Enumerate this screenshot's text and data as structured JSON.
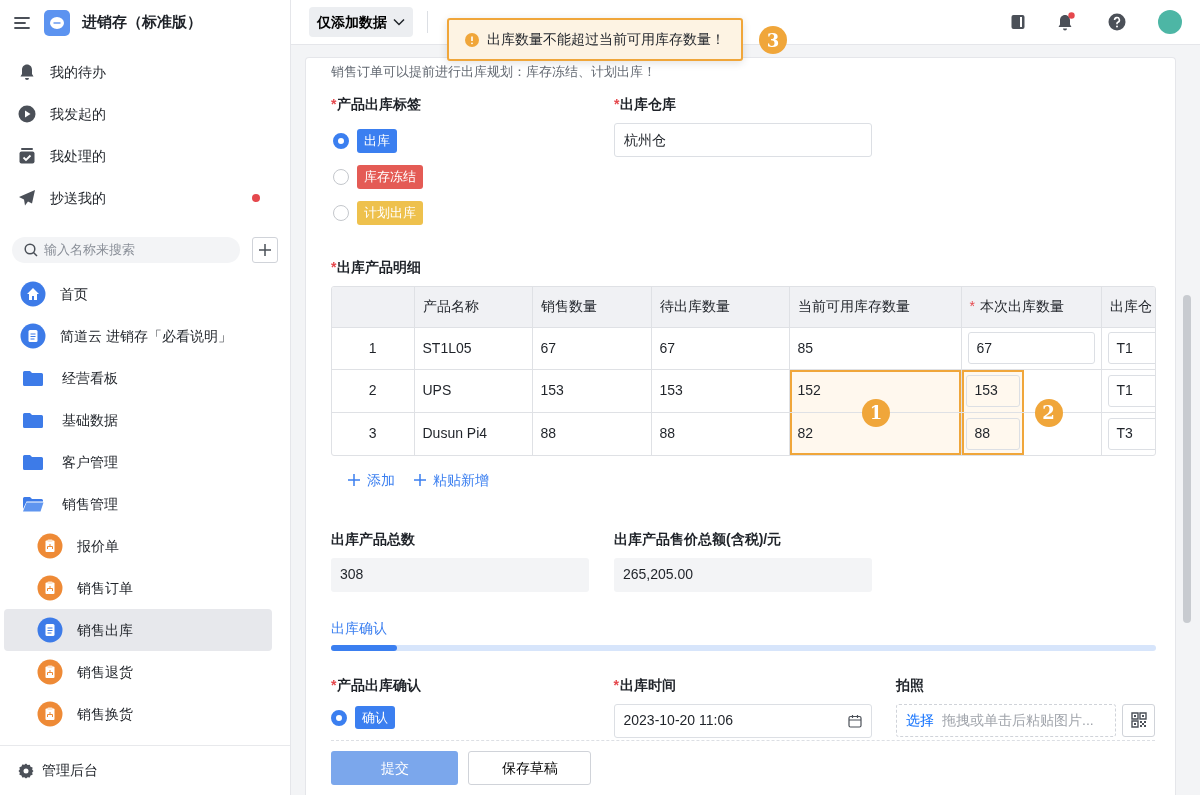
{
  "app": {
    "title": "进销存（标准版）"
  },
  "sidebar": {
    "quick_items": [
      {
        "label": "我的待办",
        "kind": "bell",
        "unread": false
      },
      {
        "label": "我发起的",
        "kind": "play",
        "unread": false
      },
      {
        "label": "我处理的",
        "kind": "tray",
        "unread": false
      },
      {
        "label": "抄送我的",
        "kind": "send",
        "unread": true
      }
    ],
    "search": {
      "placeholder": "输入名称来搜索"
    },
    "nav": [
      {
        "label": "首页",
        "kind": "home",
        "selected": false
      },
      {
        "label": "简道云 进销存「必看说明」",
        "kind": "doc",
        "selected": false
      },
      {
        "label": "经营看板",
        "kind": "folder",
        "selected": false
      },
      {
        "label": "基础数据",
        "kind": "folder",
        "selected": false
      },
      {
        "label": "客户管理",
        "kind": "folder",
        "selected": false
      },
      {
        "label": "销售管理",
        "kind": "folder-open",
        "selected": false,
        "children": [
          {
            "label": "报价单",
            "kind": "clipboard",
            "selected": false
          },
          {
            "label": "销售订单",
            "kind": "clipboard",
            "selected": false
          },
          {
            "label": "销售出库",
            "kind": "doc",
            "selected": true
          },
          {
            "label": "销售退货",
            "kind": "clipboard",
            "selected": false
          },
          {
            "label": "销售换货",
            "kind": "clipboard",
            "selected": false
          }
        ]
      }
    ],
    "footer": {
      "label": "管理后台"
    }
  },
  "topbar": {
    "mode_button": "仅添加数据",
    "notification_unread": true
  },
  "toast": {
    "message": "出库数量不能超过当前可用库存数量！",
    "callout": "3"
  },
  "form": {
    "notice": "销售订单可以提前进行出库规划：库存冻结、计划出库！",
    "tag_field": {
      "label": "产品出库标签",
      "required_mark": "*",
      "options": [
        {
          "label": "出库",
          "color": "#3b7ff0",
          "selected": true
        },
        {
          "label": "库存冻结",
          "color": "#e45b55",
          "selected": false
        },
        {
          "label": "计划出库",
          "color": "#eec14d",
          "selected": false
        }
      ]
    },
    "warehouse_field": {
      "label": "出库仓库",
      "required_mark": "*",
      "value": "杭州仓"
    },
    "detail": {
      "label": "出库产品明细",
      "required_mark": "*",
      "columns": [
        {},
        {
          "label": "产品名称"
        },
        {
          "label": "销售数量"
        },
        {
          "label": "待出库数量"
        },
        {
          "label": "当前可用库存数量",
          "callout": "1"
        },
        {
          "label": "本次出库数量",
          "required_mark": "*",
          "callout": "2"
        },
        {
          "label": "出库仓"
        }
      ],
      "rows": [
        {
          "cells": [
            {
              "text": "1"
            },
            {
              "text": "ST1L05"
            },
            {
              "text": "67"
            },
            {
              "text": "67"
            },
            {
              "text": "85",
              "flagged": false
            },
            {
              "text": "67",
              "kind": "input",
              "flagged": false
            },
            {
              "text": "T1",
              "kind": "input"
            }
          ]
        },
        {
          "cells": [
            {
              "text": "2"
            },
            {
              "text": "UPS"
            },
            {
              "text": "153"
            },
            {
              "text": "153"
            },
            {
              "text": "152",
              "flagged": true
            },
            {
              "text": "153",
              "kind": "input",
              "flagged": true
            },
            {
              "text": "T1",
              "kind": "input"
            }
          ]
        },
        {
          "cells": [
            {
              "text": "3"
            },
            {
              "text": "Dusun Pi4"
            },
            {
              "text": "88"
            },
            {
              "text": "88"
            },
            {
              "text": "82",
              "flagged": true
            },
            {
              "text": "88",
              "kind": "input",
              "flagged": true
            },
            {
              "text": "T3",
              "kind": "input"
            }
          ]
        }
      ],
      "actions": [
        "添加",
        "粘贴新增"
      ]
    },
    "totals": [
      {
        "label": "出库产品总数",
        "value": "308"
      },
      {
        "label": "出库产品售价总额(含税)/元",
        "value": "265,205.00"
      }
    ],
    "section_tab": {
      "label": "出库确认",
      "selected": true
    },
    "confirm_field": {
      "label": "产品出库确认",
      "required_mark": "*",
      "options": [
        {
          "label": "确认",
          "color": "#3b7ff0",
          "selected": true
        }
      ]
    },
    "time_field": {
      "label": "出库时间",
      "required_mark": "*",
      "value": "2023-10-20 11:06"
    },
    "photo_field": {
      "label": "拍照",
      "link": "选择",
      "placeholder": "拖拽或单击后粘贴图片..."
    }
  },
  "buttons": [
    {
      "label": "提交",
      "kind": "primary",
      "disabled": true
    },
    {
      "label": "保存草稿",
      "kind": "secondary",
      "disabled": false
    }
  ]
}
